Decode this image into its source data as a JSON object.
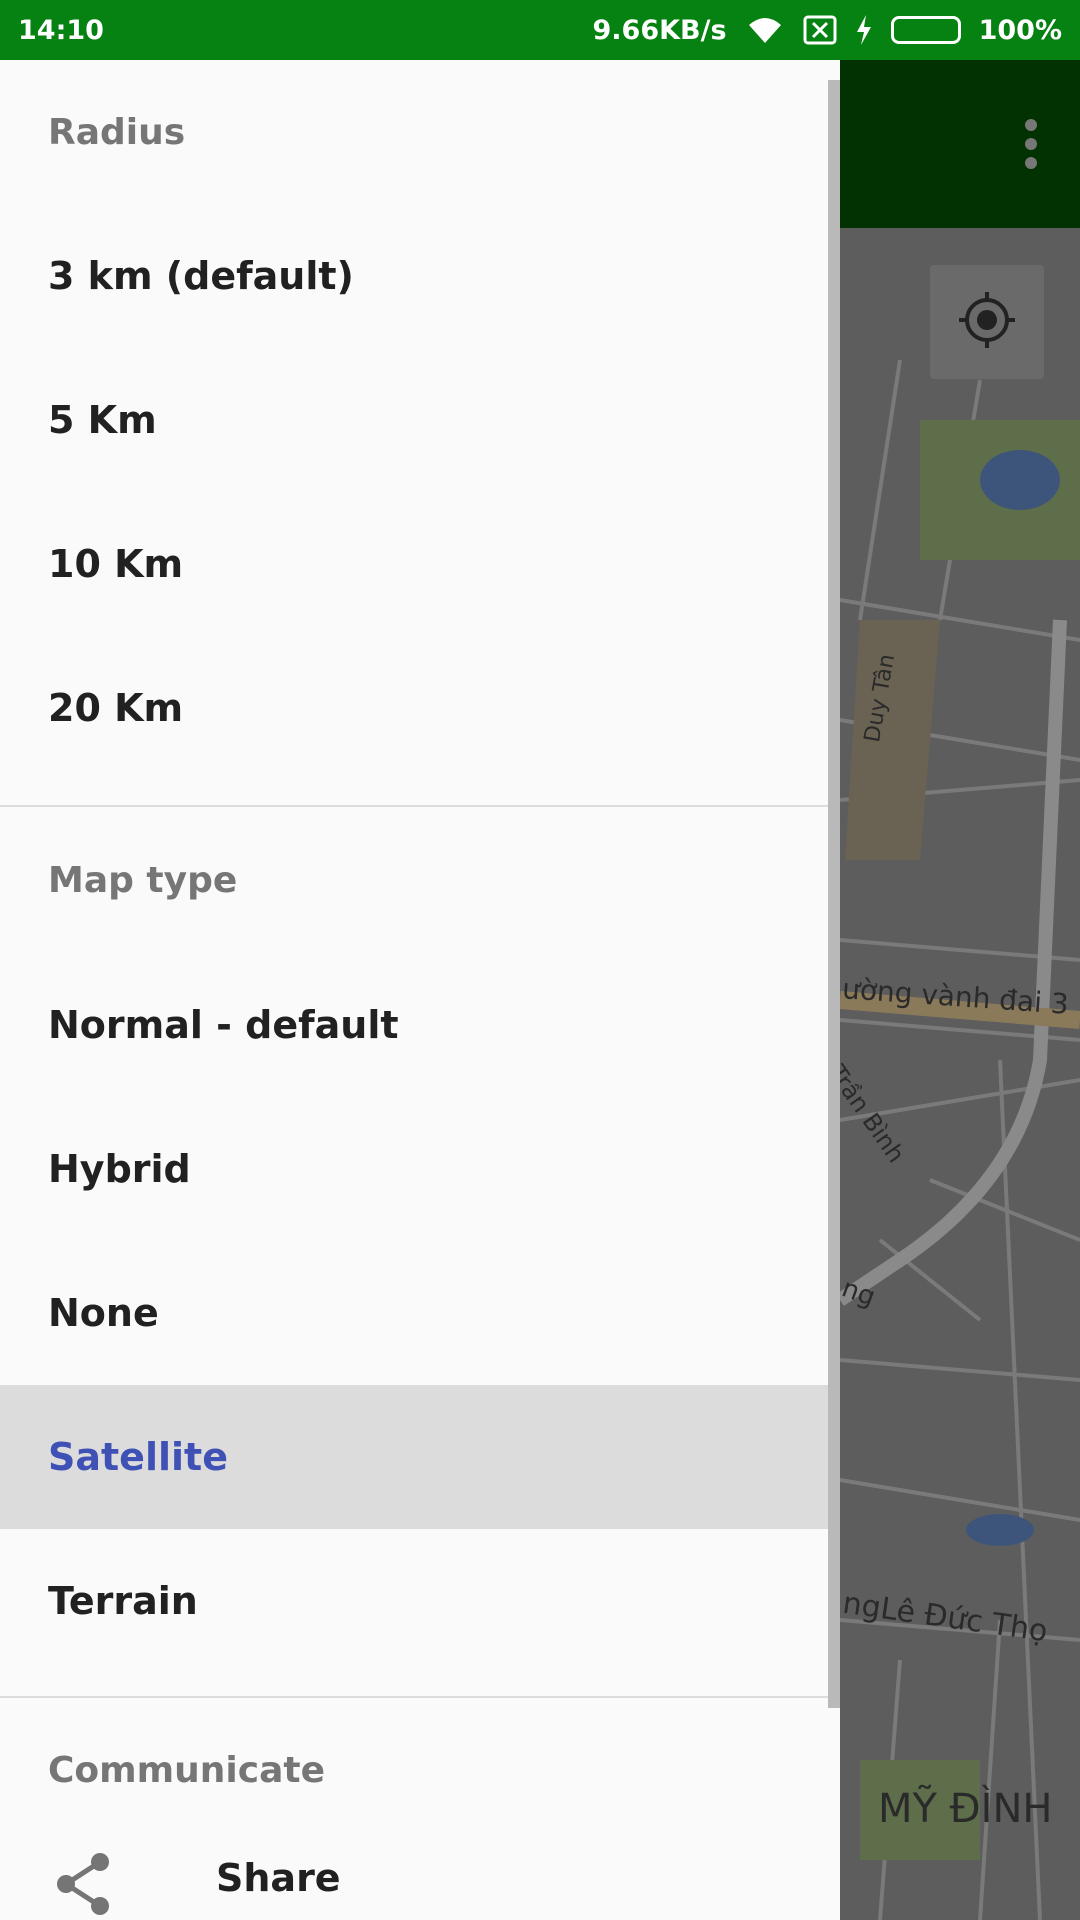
{
  "status_bar": {
    "time": "14:10",
    "speed": "9.66KB/s",
    "battery": "100%"
  },
  "drawer": {
    "radius_title": "Radius",
    "radius_options": [
      "3 km (default)",
      "5 Km",
      "10 Km",
      "20 Km"
    ],
    "maptype_title": "Map type",
    "maptype_options": [
      "Normal - default",
      "Hybrid",
      "None",
      "Satellite",
      "Terrain"
    ],
    "selected_maptype": "Satellite",
    "communicate_title": "Communicate",
    "share_label": "Share"
  },
  "map": {
    "labels": {
      "duy_tan": "Duy Tân",
      "vanh_dai": "ường vành đai 3",
      "tran_binh": "Trần Bình",
      "ng": "ng",
      "le_duc_tho": "ngLê Đức Thọ",
      "my_dinh": "MỸ ĐÌNH"
    }
  },
  "colors": {
    "status_bar": "#058211",
    "app_bar": "#023102",
    "selected_text": "#3f51b5",
    "selected_bg": "#dcdcdc"
  },
  "icons": {
    "overflow": "more-vert-icon",
    "locate": "my-location-icon",
    "share": "share-icon",
    "wifi": "wifi-icon",
    "sim": "no-sim-icon",
    "charging": "charging-icon"
  }
}
